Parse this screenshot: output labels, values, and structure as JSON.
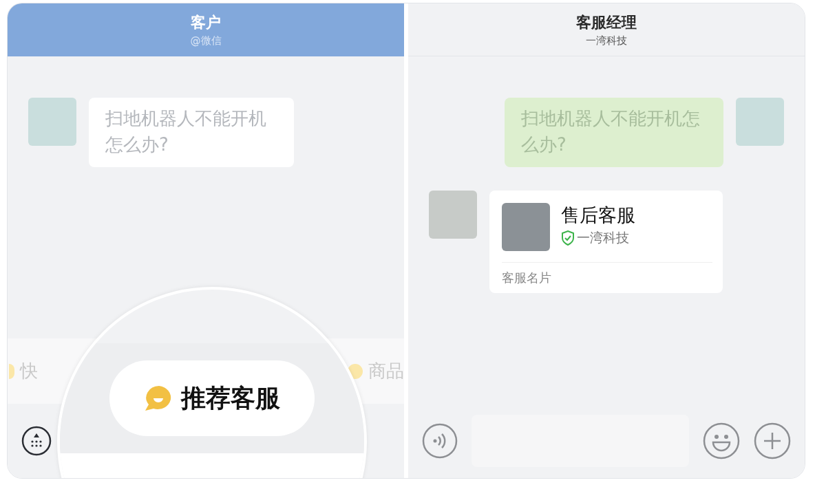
{
  "customer_panel": {
    "title": "客户",
    "subtitle": "@微信",
    "messages": [
      {
        "text": "扫地机器人不能开机怎么办?"
      }
    ],
    "quick_replies": [
      {
        "label": "快"
      },
      {
        "label": "商品"
      }
    ],
    "recommend_button": {
      "label": "推荐客服"
    }
  },
  "agent_panel": {
    "title": "客服经理",
    "subtitle": "一湾科技",
    "messages": [
      {
        "kind": "text",
        "text": "扫地机器人不能开机怎么办?"
      },
      {
        "kind": "card",
        "title": "售后客服",
        "company": "一湾科技",
        "verified": true,
        "footer": "客服名片"
      }
    ]
  }
}
